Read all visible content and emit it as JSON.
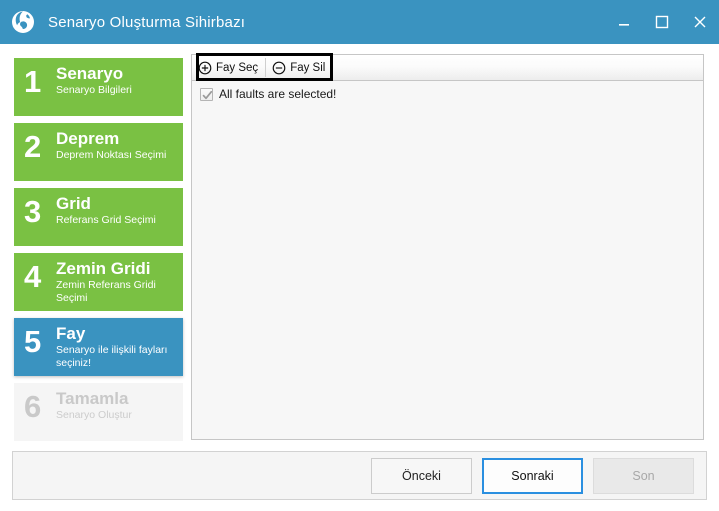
{
  "window": {
    "title": "Senaryo Oluşturma Sihirbazı",
    "icon": "globe-icon",
    "title_bar_color": "#3a93c0",
    "controls": {
      "minimize": "minimize-icon",
      "maximize": "maximize-icon",
      "close": "close-icon"
    }
  },
  "sidebar": {
    "steps": [
      {
        "number": "1",
        "title": "Senaryo",
        "subtitle": "Senaryo Bilgileri",
        "state": "completed",
        "color": "#7ac143"
      },
      {
        "number": "2",
        "title": "Deprem",
        "subtitle": "Deprem Noktası Seçimi",
        "state": "completed",
        "color": "#7ac143"
      },
      {
        "number": "3",
        "title": "Grid",
        "subtitle": "Referans Grid Seçimi",
        "state": "completed",
        "color": "#7ac143"
      },
      {
        "number": "4",
        "title": "Zemin Gridi",
        "subtitle": "Zemin Referans Gridi Seçimi",
        "state": "completed",
        "color": "#7ac143"
      },
      {
        "number": "5",
        "title": "Fay",
        "subtitle": "Senaryo ile ilişkili fayları seçiniz!",
        "state": "active",
        "color": "#3a93c0"
      },
      {
        "number": "6",
        "title": "Tamamla",
        "subtitle": "Senaryo Oluştur",
        "state": "disabled",
        "color": "#f5f5f5"
      }
    ]
  },
  "main": {
    "toolbar": {
      "select_fault_label": "Fay Seç",
      "select_fault_icon": "circle-plus-icon",
      "delete_fault_label": "Fay Sil",
      "delete_fault_icon": "circle-minus-icon",
      "highlight_color": "#000000"
    },
    "checkbox": {
      "label": "All faults are selected!",
      "checked": "true",
      "enabled": "false"
    }
  },
  "footer": {
    "previous_label": "Önceki",
    "next_label": "Sonraki",
    "finish_label": "Son",
    "focus_color": "#2a8fe0"
  }
}
